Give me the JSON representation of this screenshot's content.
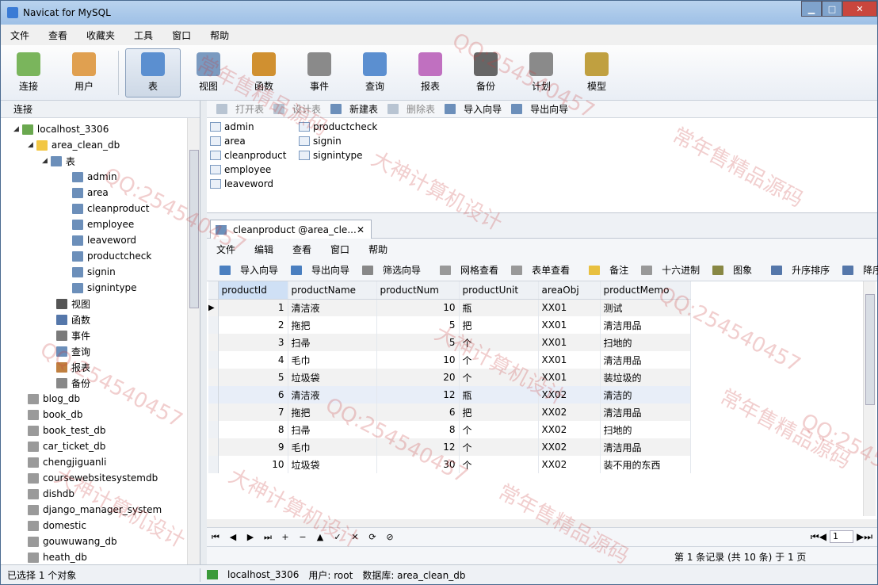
{
  "window": {
    "title": "Navicat for MySQL",
    "min": "▁",
    "max": "□",
    "close": "✕"
  },
  "menubar": [
    "文件",
    "查看",
    "收藏夹",
    "工具",
    "窗口",
    "帮助"
  ],
  "toolbar": [
    {
      "label": "连接",
      "icon": "connection-icon"
    },
    {
      "label": "用户",
      "icon": "user-icon"
    },
    {
      "label": "表",
      "icon": "table-icon"
    },
    {
      "label": "视图",
      "icon": "view-icon"
    },
    {
      "label": "函数",
      "icon": "function-icon"
    },
    {
      "label": "事件",
      "icon": "event-icon"
    },
    {
      "label": "查询",
      "icon": "query-icon"
    },
    {
      "label": "报表",
      "icon": "report-icon"
    },
    {
      "label": "备份",
      "icon": "backup-icon"
    },
    {
      "label": "计划",
      "icon": "schedule-icon"
    },
    {
      "label": "模型",
      "icon": "model-icon"
    }
  ],
  "left": {
    "header": "连接",
    "tree": [
      {
        "label": "localhost_3306",
        "exp": "◢",
        "level": 0,
        "color": "#6aa84f"
      },
      {
        "label": "area_clean_db",
        "exp": "◢",
        "level": 1,
        "color": "#f2c744"
      },
      {
        "label": "表",
        "exp": "◢",
        "level": 2,
        "color": "#6c8fba"
      },
      {
        "label": "admin",
        "level": 4,
        "color": "#6c8fba"
      },
      {
        "label": "area",
        "level": 4,
        "color": "#6c8fba"
      },
      {
        "label": "cleanproduct",
        "level": 4,
        "color": "#6c8fba"
      },
      {
        "label": "employee",
        "level": 4,
        "color": "#6c8fba"
      },
      {
        "label": "leaveword",
        "level": 4,
        "color": "#6c8fba"
      },
      {
        "label": "productcheck",
        "level": 4,
        "color": "#6c8fba"
      },
      {
        "label": "signin",
        "level": 4,
        "color": "#6c8fba"
      },
      {
        "label": "signintype",
        "level": 4,
        "color": "#6c8fba"
      },
      {
        "label": "视图",
        "level": 3,
        "color": "#555555"
      },
      {
        "label": "函数",
        "level": 3,
        "color": "#5577aa"
      },
      {
        "label": "事件",
        "level": 3,
        "color": "#7a7a7a"
      },
      {
        "label": "查询",
        "level": 3,
        "color": "#6c8fba"
      },
      {
        "label": "报表",
        "level": 3,
        "color": "#c08040"
      },
      {
        "label": "备份",
        "level": 3,
        "color": "#888888"
      },
      {
        "label": "blog_db",
        "level": 1,
        "color": "#9a9a9a"
      },
      {
        "label": "book_db",
        "level": 1,
        "color": "#9a9a9a"
      },
      {
        "label": "book_test_db",
        "level": 1,
        "color": "#9a9a9a"
      },
      {
        "label": "car_ticket_db",
        "level": 1,
        "color": "#9a9a9a"
      },
      {
        "label": "chengjiguanli",
        "level": 1,
        "color": "#9a9a9a"
      },
      {
        "label": "coursewebsitesystemdb",
        "level": 1,
        "color": "#9a9a9a"
      },
      {
        "label": "dishdb",
        "level": 1,
        "color": "#9a9a9a"
      },
      {
        "label": "django_manager_system",
        "level": 1,
        "color": "#9a9a9a"
      },
      {
        "label": "domestic",
        "level": 1,
        "color": "#9a9a9a"
      },
      {
        "label": "gouwuwang_db",
        "level": 1,
        "color": "#9a9a9a"
      },
      {
        "label": "heath_db",
        "level": 1,
        "color": "#9a9a9a"
      }
    ]
  },
  "objbar": [
    {
      "label": "打开表",
      "disabled": true
    },
    {
      "label": "设计表",
      "disabled": true
    },
    {
      "label": "新建表",
      "disabled": false
    },
    {
      "label": "删除表",
      "disabled": true
    },
    {
      "label": "导入向导",
      "disabled": false
    },
    {
      "label": "导出向导",
      "disabled": false
    }
  ],
  "objects": [
    "admin",
    "area",
    "cleanproduct",
    "employee",
    "leaveword",
    "productcheck",
    "signin",
    "signintype"
  ],
  "tab": {
    "label": "cleanproduct @area_cle...",
    "close": "✕"
  },
  "innermenu": [
    "文件",
    "编辑",
    "查看",
    "窗口",
    "帮助"
  ],
  "innertb": [
    {
      "label": "导入向导",
      "color": "#4a7fc0"
    },
    {
      "label": "导出向导",
      "color": "#4a7fc0"
    },
    {
      "label": "筛选向导",
      "color": "#888888"
    },
    {
      "label": "网格查看",
      "color": "#999999"
    },
    {
      "label": "表单查看",
      "color": "#999999"
    },
    {
      "label": "备注",
      "color": "#e8c040"
    },
    {
      "label": "十六进制",
      "color": "#999999"
    },
    {
      "label": "图象",
      "color": "#888844"
    },
    {
      "label": "升序排序",
      "color": "#5577aa"
    },
    {
      "label": "降序排序",
      "color": "#5577aa"
    }
  ],
  "grid": {
    "columns": [
      "productId",
      "productName",
      "productNum",
      "productUnit",
      "areaObj",
      "productMemo"
    ],
    "rows": [
      [
        "1",
        "清洁液",
        "10",
        "瓶",
        "XX01",
        "测试"
      ],
      [
        "2",
        "拖把",
        "5",
        "把",
        "XX01",
        "清洁用品"
      ],
      [
        "3",
        "扫帚",
        "5",
        "个",
        "XX01",
        "扫地的"
      ],
      [
        "4",
        "毛巾",
        "10",
        "个",
        "XX01",
        "清洁用品"
      ],
      [
        "5",
        "垃圾袋",
        "20",
        "个",
        "XX01",
        "装垃圾的"
      ],
      [
        "6",
        "清洁液",
        "12",
        "瓶",
        "XX02",
        "清洁的"
      ],
      [
        "7",
        "拖把",
        "6",
        "把",
        "XX02",
        "清洁用品"
      ],
      [
        "8",
        "扫帚",
        "8",
        "个",
        "XX02",
        "扫地的"
      ],
      [
        "9",
        "毛巾",
        "12",
        "个",
        "XX02",
        "清洁用品"
      ],
      [
        "10",
        "垃圾袋",
        "30",
        "个",
        "XX02",
        "装不用的东西"
      ]
    ]
  },
  "nav": {
    "buttons": [
      "⏮",
      "◀",
      "▶",
      "⏭",
      "+",
      "−",
      "▲",
      "✓",
      "✕",
      "⟳",
      "⊘"
    ],
    "page": "1"
  },
  "recinfo": "第 1 条记录 (共 10 条) 于 1 页",
  "status": {
    "left": "已选择 1 个对象",
    "conn": "localhost_3306",
    "user": "用户: root",
    "db": "数据库: area_clean_db"
  },
  "watermarks": [
    "QQ:254540457",
    "大神计算机设计",
    "常年售精品源码"
  ]
}
